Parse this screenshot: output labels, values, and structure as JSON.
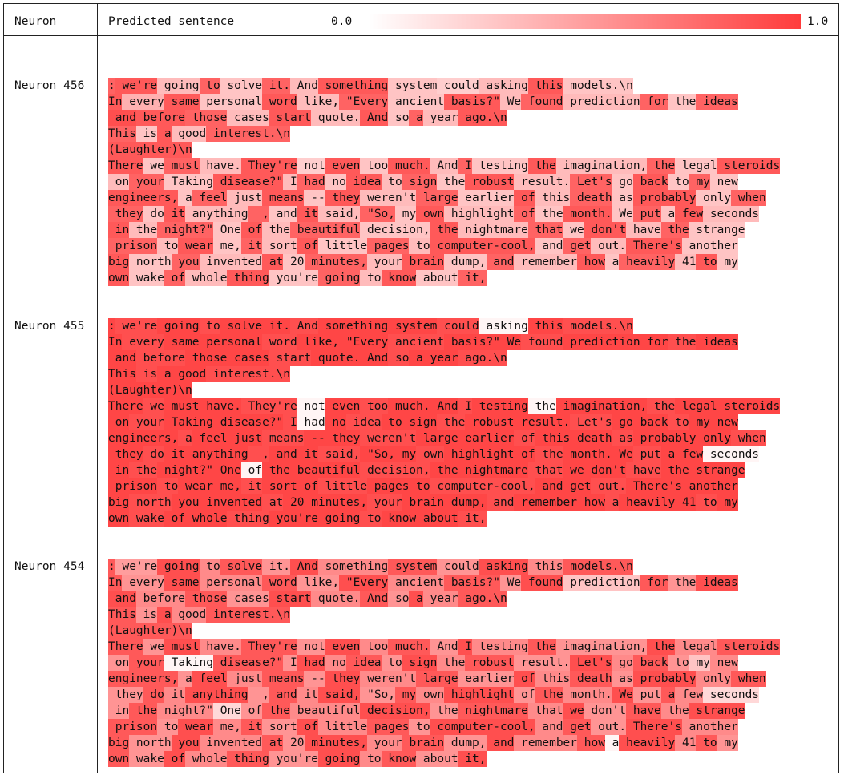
{
  "header": {
    "neuron_label": "Neuron",
    "predicted_label": "Predicted sentence",
    "scale_min": "0.0",
    "scale_max": "1.0"
  },
  "heat_color": "#ff3c3c",
  "lines": [
    ": we're going to solve it. And something system could asking this models.\\n",
    "In every same personal word like, \"Every ancient basis?\" We found prediction for the ideas",
    " and before those cases start quote. And so a year ago.\\n",
    "This is a good interest.\\n",
    "(Laughter)\\n",
    "There we must have. They're not even too much. And I testing the imagination, the legal steroids",
    " on your Taking disease?\" I had no idea to sign the robust result. Let's go back to my new",
    "engineers, a feel just means -- they weren't large earlier of this death as probably only when",
    " they do it anything  , and it said, \"So, my own highlight of the month. We put a few seconds",
    " in the night?\" One of the beautiful decision, the nightmare that we don't have the strange",
    " prison to wear me, it sort of little pages to computer-cool, and get out. There's another",
    "big north you invented at 20 minutes, your brain dump, and remember how a heavily 41 to my",
    "own wake of whole thing you're going to know about it,"
  ],
  "neurons": [
    {
      "label": "Neuron 456",
      "levels": [
        [
          0.8,
          0.85,
          0.35,
          0.8,
          0.3,
          0.8,
          0.35,
          0.85,
          0.3,
          0.25,
          0.35,
          0.85,
          0.3,
          0.35,
          0.75,
          0.35,
          0.3,
          0.9,
          0.35,
          0.3,
          0.25
        ],
        [
          0.85,
          0.4,
          0.85,
          0.3,
          0.85,
          0.35,
          0.8,
          0.3,
          0.85,
          0.35,
          0.8,
          0.35,
          0.8,
          0.3,
          0.8,
          0.35,
          0.9,
          0.35,
          0.8,
          0.3,
          0.8,
          0.4,
          0.85,
          0.3,
          0.8,
          0.35,
          0.85,
          0.3,
          0.8
        ],
        [
          0.9,
          0.85,
          0.8,
          0.35,
          0.85,
          0.35,
          0.85,
          0.3,
          0.8,
          0.35,
          0.85,
          0.35,
          0.3,
          0.85,
          0.3,
          0.9,
          0.35,
          0.25,
          0.3,
          0.85,
          0.25
        ],
        [
          0.8,
          0.3,
          0.85,
          0.35,
          0.8,
          0.3,
          0.85,
          0.35,
          0.8,
          0.3
        ],
        [
          0.85,
          0.8,
          0.3,
          0.25
        ],
        [
          0.85,
          0.3,
          0.8,
          0.35,
          0.85,
          0.25,
          0.85,
          0.3,
          0.85,
          0.35,
          0.8,
          0.3,
          0.85,
          0.35,
          0.8,
          0.3,
          0.85,
          0.3,
          0.8,
          0.3,
          0.85,
          0.35,
          0.8,
          0.3,
          0.85,
          0.3,
          0.8,
          0.35,
          0.85,
          0.4,
          0.8,
          0.3
        ],
        [
          0.35,
          0.8,
          0.3,
          0.85,
          0.35,
          0.8,
          0.3,
          0.85,
          0.35,
          0.8,
          0.3,
          0.85,
          0.35,
          0.8,
          0.3,
          0.85,
          0.3,
          0.8,
          0.3,
          0.85,
          0.3,
          0.8,
          0.35,
          0.85,
          0.3,
          0.8,
          0.3,
          0.85,
          0.35,
          0.8,
          0.3
        ],
        [
          0.85,
          0.3,
          0.8,
          0.35,
          0.85,
          0.3,
          0.85,
          0.35,
          0.8,
          0.3,
          0.85,
          0.35,
          0.8,
          0.3,
          0.85,
          0.3,
          0.8,
          0.3,
          0.85,
          0.35,
          0.8,
          0.3,
          0.85,
          0.35,
          0.8,
          0.3,
          0.85,
          0.3,
          0.8
        ],
        [
          0.8,
          0.3,
          0.85,
          0.35,
          0.8,
          0.3,
          0.85,
          0.35,
          0.8,
          0.3,
          0.85,
          0.35,
          0.8,
          0.3,
          0.85,
          0.3,
          0.8,
          0.3,
          0.85,
          0.35,
          0.8,
          0.3,
          0.85,
          0.35,
          0.8,
          0.3,
          0.85,
          0.3
        ],
        [
          0.85,
          0.35,
          0.8,
          0.3,
          0.85,
          0.35,
          0.8,
          0.3,
          0.85,
          0.35,
          0.8,
          0.3,
          0.85,
          0.35,
          0.8,
          0.3,
          0.85,
          0.3,
          0.8,
          0.35,
          0.85,
          0.3,
          0.8,
          0.35,
          0.85,
          0.3,
          0.8,
          0.3
        ],
        [
          0.8,
          0.35,
          0.85,
          0.3,
          0.8,
          0.35,
          0.85,
          0.3,
          0.8,
          0.35,
          0.85,
          0.3,
          0.8,
          0.35,
          0.85,
          0.3,
          0.8,
          0.3,
          0.85,
          0.35,
          0.8,
          0.3,
          0.85,
          0.35,
          0.8,
          0.2,
          0.85,
          0.3
        ],
        [
          0.85,
          0.3,
          0.8,
          0.35,
          0.85,
          0.3,
          0.8,
          0.35,
          0.85,
          0.3,
          0.8,
          0.35,
          0.85,
          0.3,
          0.8,
          0.35,
          0.85,
          0.3,
          0.8,
          0.3,
          0.85,
          0.35,
          0.8,
          0.3,
          0.85,
          0.35,
          0.8,
          0.3
        ],
        [
          0.85,
          0.3,
          0.8,
          0.35,
          0.85,
          0.3,
          0.8,
          0.35,
          0.85,
          0.3,
          0.8,
          0.35,
          0.85,
          0.3,
          0.8,
          0.35,
          0.85,
          0.3
        ]
      ]
    },
    {
      "label": "Neuron 455",
      "levels": [
        [
          0.95,
          0.9,
          0.95,
          0.9,
          0.95,
          0.95,
          0.9,
          0.95,
          0.95,
          0.9,
          0.05,
          0.95,
          0.9,
          0.95,
          0.9,
          0.95,
          0.95,
          0.9,
          0.95,
          0.05,
          0.95
        ],
        [
          0.95,
          0.9,
          0.95,
          0.95,
          0.9,
          0.95,
          0.95,
          0.9,
          0.95,
          0.95,
          0.9,
          0.95,
          0.95,
          0.9,
          0.95,
          0.95,
          0.9,
          0.95,
          0.95,
          0.9,
          0.05,
          0.95,
          0.9,
          0.95,
          0.95,
          0.9,
          0.95,
          0.95,
          0.9
        ],
        [
          0.95,
          0.9,
          0.95,
          0.95,
          0.9,
          0.95,
          0.95,
          0.9,
          0.95,
          0.95,
          0.9,
          0.95,
          0.05,
          0.95,
          0.9,
          0.95,
          0.95,
          0.9,
          0.95,
          0.05,
          0.95
        ],
        [
          0.95,
          0.9,
          0.95,
          0.95,
          0.9,
          0.95,
          0.95,
          0.9,
          0.05,
          0.95
        ],
        [
          0.95,
          0.9,
          0.05,
          0.05
        ],
        [
          0.95,
          0.9,
          0.95,
          0.95,
          0.9,
          0.05,
          0.95,
          0.9,
          0.95,
          0.95,
          0.9,
          0.95,
          0.05,
          0.95,
          0.9,
          0.95,
          0.95,
          0.9,
          0.95,
          0.95,
          0.9,
          0.95,
          0.95,
          0.9,
          0.95,
          0.95,
          0.9,
          0.95,
          0.95,
          0.9,
          0.95,
          0.95
        ],
        [
          0.95,
          0.9,
          0.95,
          0.95,
          0.9,
          0.05,
          0.95,
          0.9,
          0.95,
          0.95,
          0.9,
          0.95,
          0.95,
          0.9,
          0.95,
          0.95,
          0.9,
          0.95,
          0.95,
          0.05,
          0.95,
          0.9,
          0.95,
          0.95,
          0.9,
          0.95,
          0.95,
          0.9,
          0.95,
          0.95,
          0.9
        ],
        [
          0.95,
          0.9,
          0.95,
          0.95,
          0.9,
          0.95,
          0.95,
          0.9,
          0.95,
          0.95,
          0.9,
          0.95,
          0.95,
          0.9,
          0.95,
          0.95,
          0.9,
          0.95,
          0.95,
          0.9,
          0.95,
          0.95,
          0.9,
          0.95,
          0.95,
          0.9,
          0.95,
          0.95,
          0.9
        ],
        [
          0.95,
          0.9,
          0.95,
          0.95,
          0.9,
          0.95,
          0.95,
          0.9,
          0.95,
          0.95,
          0.9,
          0.95,
          0.95,
          0.9,
          0.95,
          0.95,
          0.9,
          0.95,
          0.95,
          0.05,
          0.95,
          0.95,
          0.9,
          0.95,
          0.95,
          0.9,
          0.95,
          0.95
        ],
        [
          0.95,
          0.9,
          0.95,
          0.95,
          0.05,
          0.95,
          0.95,
          0.9,
          0.95,
          0.95,
          0.9,
          0.95,
          0.95,
          0.9,
          0.95,
          0.95,
          0.9,
          0.95,
          0.95,
          0.9,
          0.95,
          0.95,
          0.9,
          0.95,
          0.95,
          0.9,
          0.95,
          0.95
        ],
        [
          0.95,
          0.9,
          0.95,
          0.95,
          0.9,
          0.95,
          0.95,
          0.9,
          0.95,
          0.95,
          0.9,
          0.95,
          0.95,
          0.9,
          0.95,
          0.95,
          0.9,
          0.95,
          0.95,
          0.9,
          0.95,
          0.95,
          0.9,
          0.95,
          0.05,
          0.9,
          0.95,
          0.95
        ],
        [
          0.95,
          0.9,
          0.95,
          0.95,
          0.9,
          0.95,
          0.95,
          0.9,
          0.95,
          0.95,
          0.9,
          0.95,
          0.95,
          0.9,
          0.95,
          0.95,
          0.9,
          0.95,
          0.95,
          0.9,
          0.95,
          0.95,
          0.9,
          0.95,
          0.95,
          0.9,
          0.95,
          0.95
        ],
        [
          0.95,
          0.9,
          0.95,
          0.95,
          0.9,
          0.95,
          0.95,
          0.9,
          0.95,
          0.95,
          0.9,
          0.95,
          0.95,
          0.9,
          0.95,
          0.95,
          0.9,
          0.95
        ]
      ]
    },
    {
      "label": "Neuron 454",
      "levels": [
        [
          0.85,
          0.5,
          0.9,
          0.6,
          0.85,
          0.55,
          0.9,
          0.6,
          0.85,
          0.55,
          0.9,
          0.6,
          0.85,
          0.55,
          0.9,
          0.6,
          0.85,
          0.55,
          0.9,
          0.6,
          0.85
        ],
        [
          0.85,
          0.55,
          0.9,
          0.6,
          0.85,
          0.55,
          0.9,
          0.6,
          0.85,
          0.55,
          0.9,
          0.3,
          0.85,
          0.55,
          0.9,
          0.6,
          0.85,
          0.55,
          0.9,
          0.6,
          0.85,
          0.55,
          0.9,
          0.6,
          0.85,
          0.2,
          0.9,
          0.6,
          0.85
        ],
        [
          0.9,
          0.6,
          0.85,
          0.55,
          0.9,
          0.6,
          0.85,
          0.55,
          0.9,
          0.6,
          0.85,
          0.55,
          0.9,
          0.6,
          0.85,
          0.55,
          0.9,
          0.6,
          0.85,
          0.55,
          0.9
        ],
        [
          0.85,
          0.55,
          0.9,
          0.6,
          0.85,
          0.55,
          0.9,
          0.6,
          0.85,
          0.55
        ],
        [
          0.85,
          0.6,
          0.9,
          0.55
        ],
        [
          0.85,
          0.55,
          0.9,
          0.6,
          0.85,
          0.55,
          0.9,
          0.6,
          0.85,
          0.55,
          0.9,
          0.6,
          0.85,
          0.55,
          0.9,
          0.6,
          0.85,
          0.55,
          0.9,
          0.2,
          0.85,
          0.55,
          0.9,
          0.6,
          0.85,
          0.55,
          0.9,
          0.6,
          0.85,
          0.55,
          0.9,
          0.6
        ],
        [
          0.55,
          0.85,
          0.05,
          0.85,
          0.55,
          0.9,
          0.6,
          0.85,
          0.55,
          0.9,
          0.6,
          0.85,
          0.55,
          0.9,
          0.6,
          0.85,
          0.55,
          0.3,
          0.6,
          0.85,
          0.55,
          0.9,
          0.6,
          0.85,
          0.55,
          0.9,
          0.6,
          0.85,
          0.55,
          0.9,
          0.6
        ],
        [
          0.85,
          0.55,
          0.9,
          0.6,
          0.85,
          0.55,
          0.9,
          0.6,
          0.85,
          0.55,
          0.9,
          0.6,
          0.85,
          0.55,
          0.9,
          0.6,
          0.85,
          0.55,
          0.9,
          0.6,
          0.85,
          0.55,
          0.9,
          0.6,
          0.85,
          0.55,
          0.9,
          0.6,
          0.85
        ],
        [
          0.55,
          0.85,
          0.6,
          0.9,
          0.55,
          0.85,
          0.6,
          0.9,
          0.55,
          0.85,
          0.6,
          0.9,
          0.55,
          0.85,
          0.6,
          0.9,
          0.55,
          0.85,
          0.6,
          0.2,
          0.55,
          0.85,
          0.6,
          0.9,
          0.55,
          0.85,
          0.6,
          0.9
        ],
        [
          0.55,
          0.85,
          0.6,
          0.2,
          0.55,
          0.85,
          0.6,
          0.9,
          0.55,
          0.85,
          0.6,
          0.9,
          0.55,
          0.85,
          0.6,
          0.9,
          0.55,
          0.85,
          0.6,
          0.9,
          0.55,
          0.85,
          0.6,
          0.9,
          0.55,
          0.85,
          0.6,
          0.9
        ],
        [
          0.85,
          0.55,
          0.9,
          0.6,
          0.85,
          0.55,
          0.9,
          0.6,
          0.85,
          0.55,
          0.9,
          0.6,
          0.85,
          0.55,
          0.9,
          0.6,
          0.85,
          0.55,
          0.9,
          0.6,
          0.85,
          0.55,
          0.9,
          0.6,
          0.85,
          0.55,
          0.9,
          0.6
        ],
        [
          0.85,
          0.55,
          0.9,
          0.6,
          0.85,
          0.55,
          0.9,
          0.6,
          0.85,
          0.55,
          0.9,
          0.6,
          0.85,
          0.05,
          0.9,
          0.6,
          0.85,
          0.55,
          0.9,
          0.6,
          0.85,
          0.55,
          0.9,
          0.6,
          0.85,
          0.55,
          0.9,
          0.6
        ],
        [
          0.85,
          0.55,
          0.9,
          0.6,
          0.85,
          0.55,
          0.9,
          0.6,
          0.85,
          0.55,
          0.9,
          0.6,
          0.85,
          0.55,
          0.9,
          0.6,
          0.85,
          0.55
        ]
      ]
    }
  ]
}
